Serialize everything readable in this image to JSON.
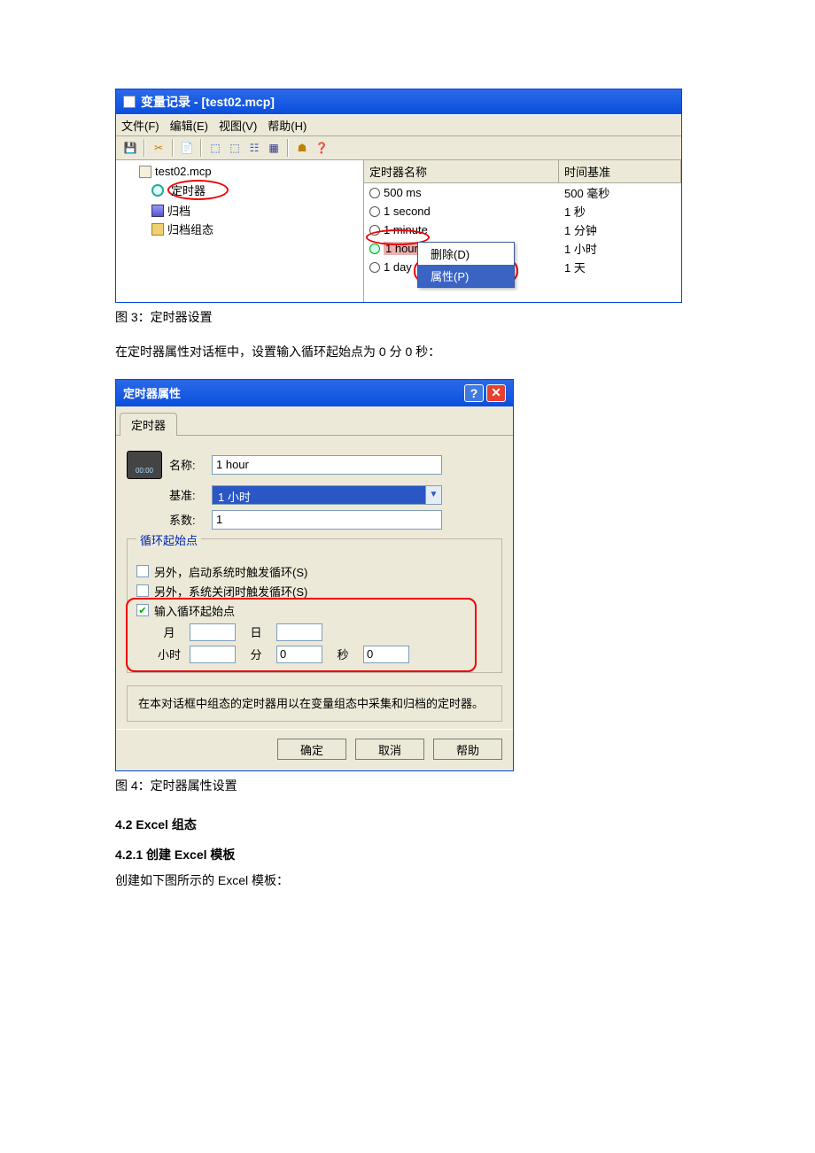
{
  "win1": {
    "title": "变量记录 - [test02.mcp]",
    "menu": [
      "文件(F)",
      "编辑(E)",
      "视图(V)",
      "帮助(H)"
    ],
    "tree": {
      "root": "test02.mcp",
      "n1": "定时器",
      "n2": "归档",
      "n3": "归档组态"
    },
    "list": {
      "hdr_name": "定时器名称",
      "hdr_base": "时间基准",
      "rows": [
        {
          "name": "500 ms",
          "base": "500 毫秒"
        },
        {
          "name": "1 second",
          "base": "1 秒"
        },
        {
          "name": "1 minute",
          "base": "1 分钟"
        },
        {
          "name": "1 hour",
          "base": "1 小时"
        },
        {
          "name": "1 day",
          "base": "1 天"
        }
      ]
    },
    "ctx": {
      "delete": "删除(D)",
      "props": "属性(P)"
    }
  },
  "cap1": "图 3：定时器设置",
  "para1": "在定时器属性对话框中，设置输入循环起始点为 0 分 0 秒：",
  "dlg": {
    "title": "定时器属性",
    "tab": "定时器",
    "lbl_name": "名称:",
    "val_name": "1 hour",
    "lbl_base": "基准:",
    "val_base": "1 小时",
    "lbl_factor": "系数:",
    "val_factor": "1",
    "grp_title": "循环起始点",
    "cb1": "另外，启动系统时触发循环(S)",
    "cb2": "另外，系统关闭时触发循环(S)",
    "cb3": "输入循环起始点",
    "lbl_month": "月",
    "lbl_day": "日",
    "lbl_hour": "小时",
    "lbl_min": "分",
    "val_min": "0",
    "lbl_sec": "秒",
    "val_sec": "0",
    "info": "在本对话框中组态的定时器用以在变量组态中采集和归档的定时器。",
    "btn_ok": "确定",
    "btn_cancel": "取消",
    "btn_help": "帮助"
  },
  "cap2": "图 4：定时器属性设置",
  "h42": "4.2 Excel 组态",
  "h421": "4.2.1  创建 Excel 模板",
  "p421": "创建如下图所示的 Excel 模板："
}
